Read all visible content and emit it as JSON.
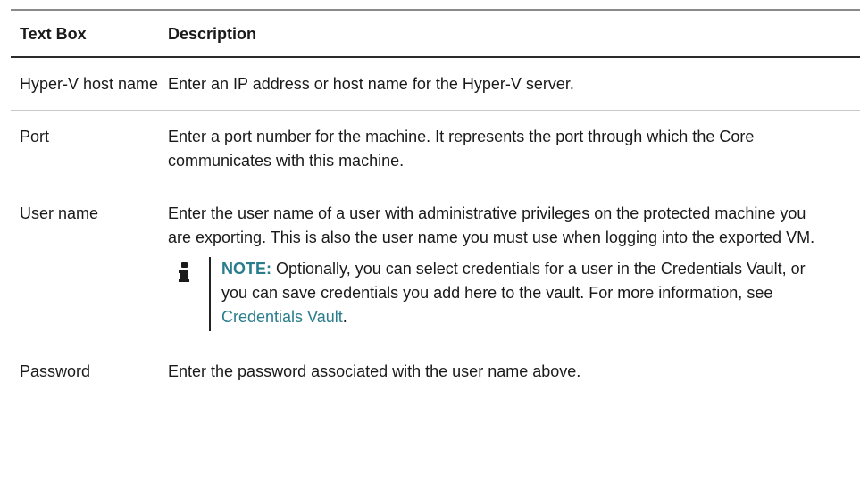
{
  "table": {
    "headers": [
      "Text Box",
      "Description"
    ],
    "rows": [
      {
        "name": "Hyper-V host name",
        "description": "Enter an IP address or host name for the Hyper-V server."
      },
      {
        "name": "Port",
        "description": "Enter a port number for the machine. It represents the port through which the Core communicates with this machine."
      },
      {
        "name": "User name",
        "description": "Enter the user name of a user with administrative privileges on the protected machine you are exporting. This is also the user name you must use when logging into the exported VM.",
        "note": {
          "icon": "info-icon",
          "label": "NOTE:",
          "text": " Optionally, you can select credentials for a user in the Credentials Vault, or you can save credentials you add here to the vault. For more information, see ",
          "link_text": "Credentials Vault",
          "suffix": "."
        }
      },
      {
        "name": "Password",
        "description": "Enter the password associated with the user name above."
      }
    ]
  },
  "colors": {
    "link": "#2a7d8c",
    "note_label": "#2a7d8c",
    "text": "#1a1a1a"
  }
}
